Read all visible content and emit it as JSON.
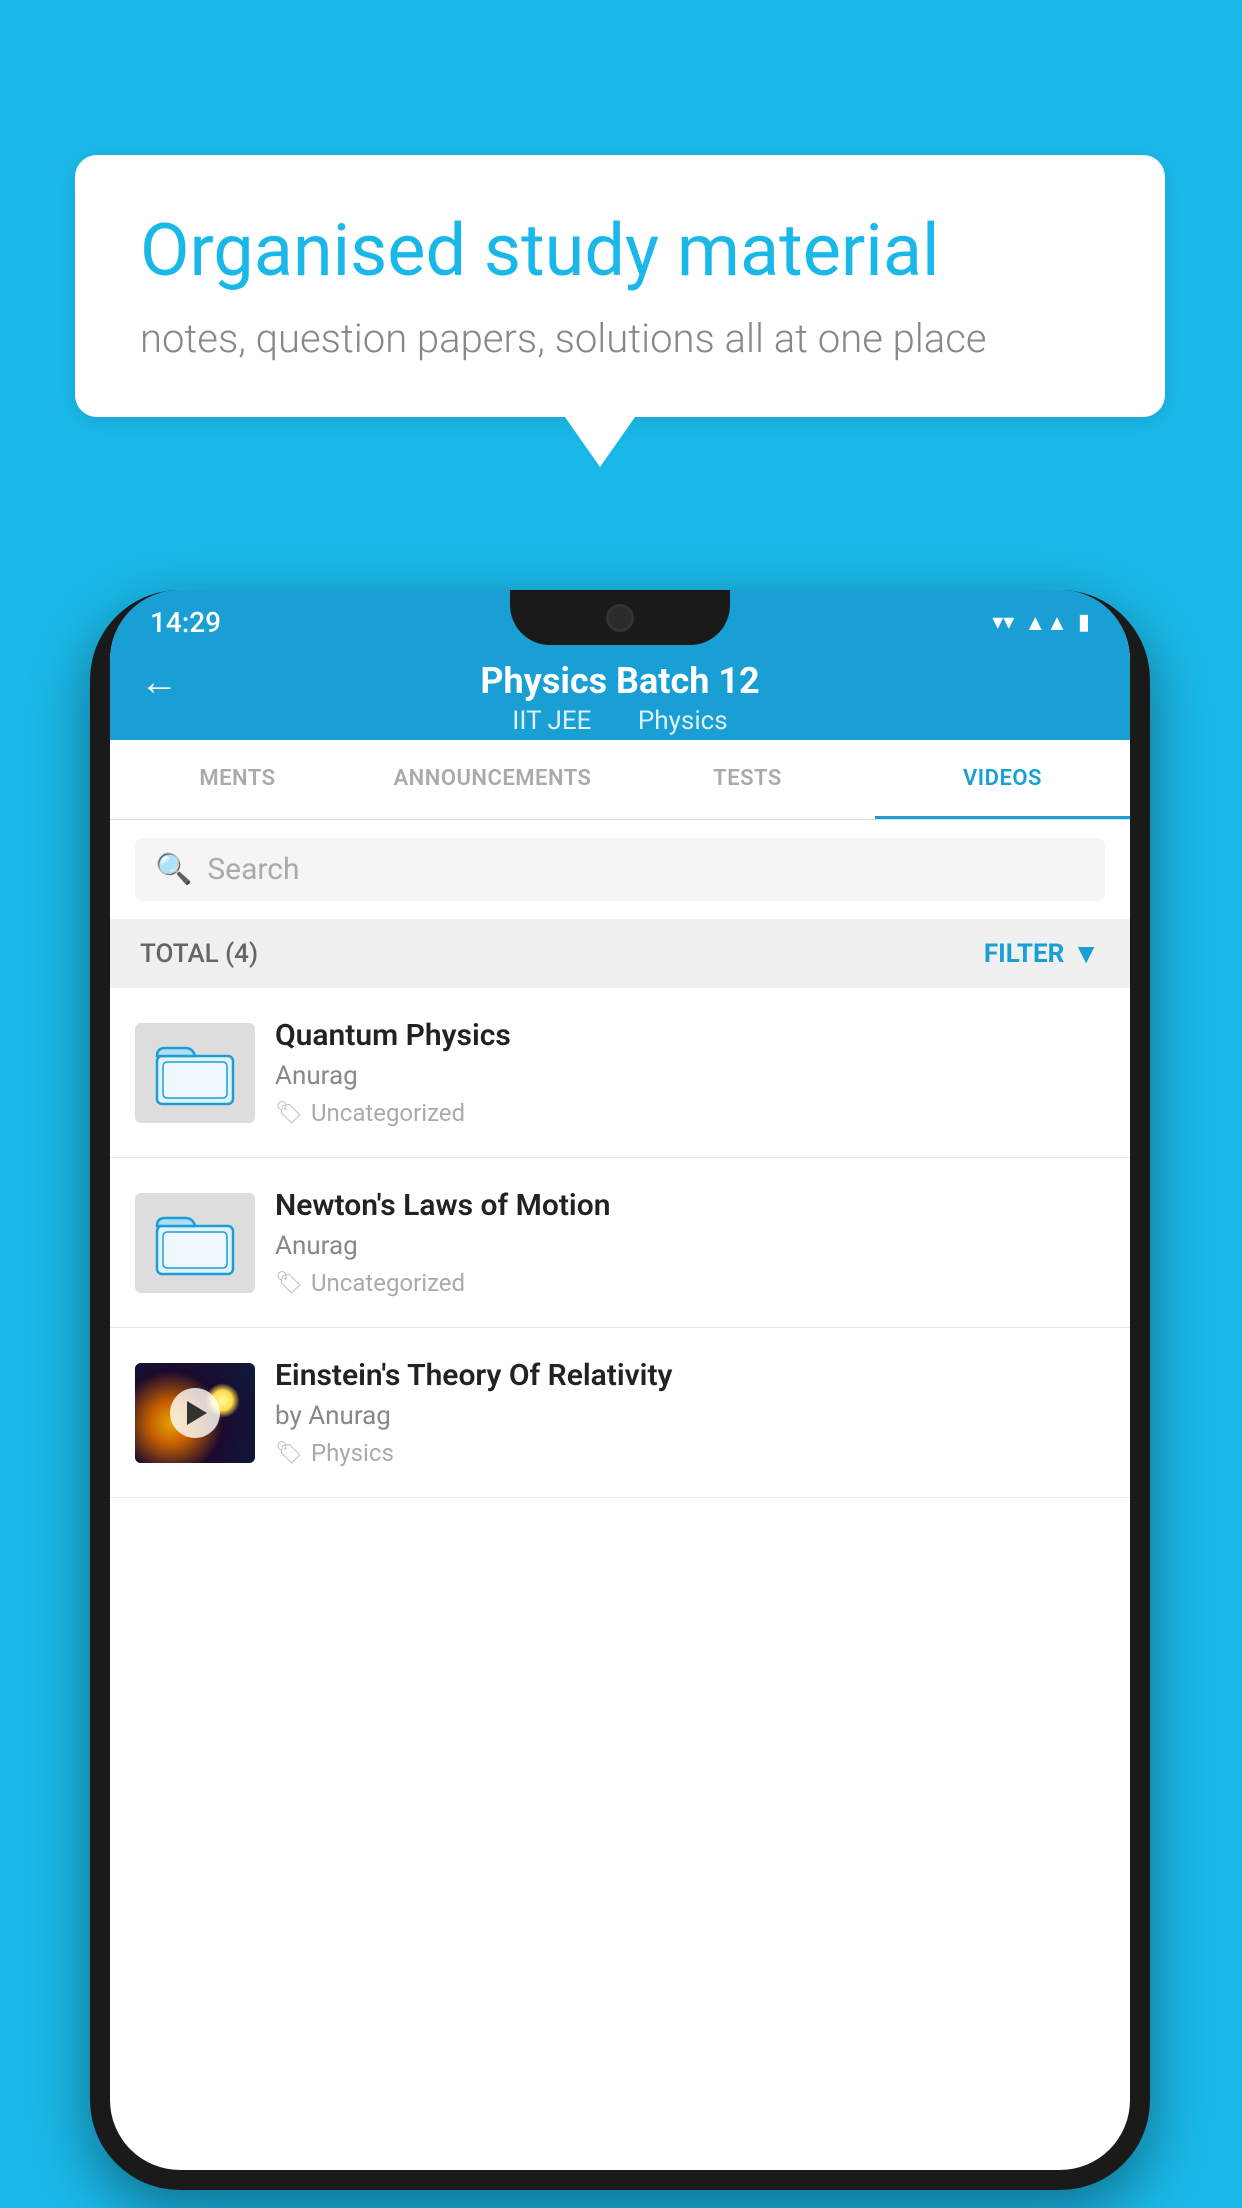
{
  "background_color": "#1ab8e8",
  "speech_bubble": {
    "title": "Organised study material",
    "subtitle": "notes, question papers, solutions all at one place"
  },
  "status_bar": {
    "time": "14:29",
    "wifi": "▼",
    "signal": "▲",
    "battery": "▮"
  },
  "header": {
    "back_label": "←",
    "title": "Physics Batch 12",
    "subtitle_tag1": "IIT JEE",
    "subtitle_tag2": "Physics"
  },
  "tabs": [
    {
      "label": "MENTS",
      "active": false
    },
    {
      "label": "ANNOUNCEMENTS",
      "active": false
    },
    {
      "label": "TESTS",
      "active": false
    },
    {
      "label": "VIDEOS",
      "active": true
    }
  ],
  "search": {
    "placeholder": "Search"
  },
  "filter_bar": {
    "total_label": "TOTAL (4)",
    "filter_label": "FILTER"
  },
  "videos": [
    {
      "title": "Quantum Physics",
      "author": "Anurag",
      "tag": "Uncategorized",
      "has_thumb": false
    },
    {
      "title": "Newton's Laws of Motion",
      "author": "Anurag",
      "tag": "Uncategorized",
      "has_thumb": false
    },
    {
      "title": "Einstein's Theory Of Relativity",
      "author": "by Anurag",
      "tag": "Physics",
      "has_thumb": true
    }
  ]
}
